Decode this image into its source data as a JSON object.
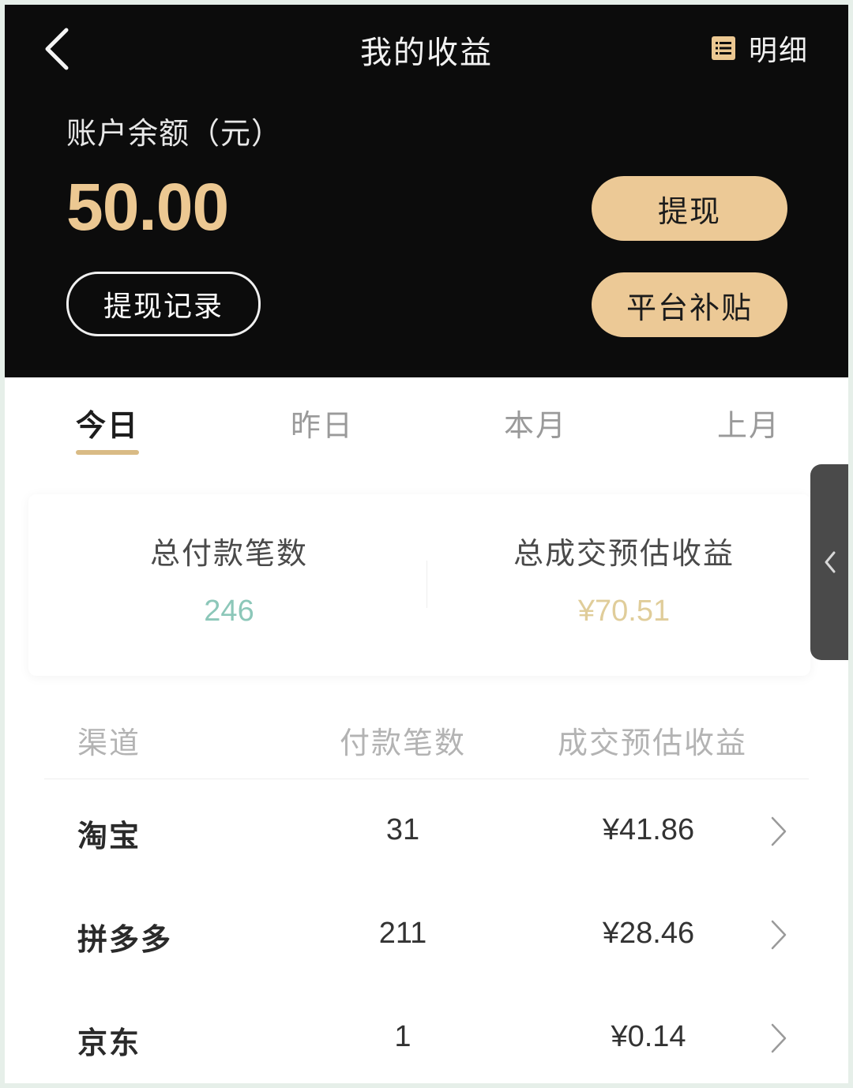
{
  "header": {
    "title": "我的收益",
    "detail_label": "明细",
    "balance_label": "账户余额（元）",
    "balance_value": "50.00",
    "withdraw_record_label": "提现记录",
    "withdraw_label": "提现",
    "subsidy_label": "平台补贴",
    "icons": {
      "back": "chevron-left-icon",
      "detail": "list-icon"
    }
  },
  "tabs": [
    {
      "label": "今日",
      "active": true
    },
    {
      "label": "昨日",
      "active": false
    },
    {
      "label": "本月",
      "active": false
    },
    {
      "label": "上月",
      "active": false
    }
  ],
  "summary": {
    "total_payments_label": "总付款笔数",
    "total_payments_value": "246",
    "total_income_label": "总成交预估收益",
    "total_income_value": "¥70.51"
  },
  "table": {
    "headers": [
      "渠道",
      "付款笔数",
      "成交预估收益"
    ],
    "rows": [
      {
        "channel": "淘宝",
        "count": "31",
        "income": "¥41.86"
      },
      {
        "channel": "拼多多",
        "count": "211",
        "income": "¥28.46"
      },
      {
        "channel": "京东",
        "count": "1",
        "income": "¥0.14"
      }
    ]
  },
  "colors": {
    "header_bg": "#0c0c0c",
    "gold": "#ecc892",
    "gold_button": "#ecc996",
    "tab_underline": "#d9bb85",
    "payments_value": "#8cc7b9",
    "income_value": "#e0cd9a",
    "handle_bg": "#4a4a4a"
  }
}
